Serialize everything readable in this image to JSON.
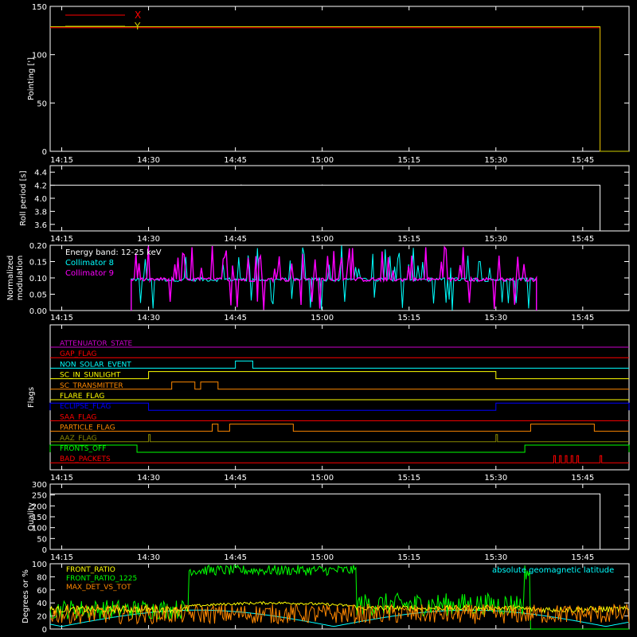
{
  "chart_data": [
    {
      "type": "line",
      "panel": "pointing",
      "ylabel": "Pointing [']",
      "ylim": [
        0,
        150
      ],
      "yticks": [
        0,
        50,
        100,
        150
      ],
      "xlim": [
        "14:13",
        "15:53"
      ],
      "xticks": [
        "14:15",
        "14:30",
        "14:45",
        "15:00",
        "15:15",
        "15:30",
        "15:45"
      ],
      "legend": "top-left",
      "series": [
        {
          "name": "X",
          "color": "#ff0000",
          "x": [
            "14:13",
            "15:48",
            "15:48",
            "15:53"
          ],
          "values": [
            128,
            128,
            0,
            0
          ]
        },
        {
          "name": "Y",
          "color": "#cccc00",
          "x": [
            "14:13",
            "15:48",
            "15:48",
            "15:53"
          ],
          "values": [
            129,
            129,
            0,
            0
          ]
        }
      ]
    },
    {
      "type": "line",
      "panel": "roll",
      "ylabel": "Roll period [s]",
      "ylim": [
        3.5,
        4.5
      ],
      "yticks": [
        "3.6",
        "3.8",
        "4.0",
        "4.2",
        "4.4"
      ],
      "series": [
        {
          "name": "",
          "color": "#ffffff",
          "x": [
            "14:13",
            "15:48",
            "15:48"
          ],
          "values": [
            4.2,
            4.2,
            3.5
          ]
        }
      ]
    },
    {
      "type": "line",
      "panel": "modulation",
      "ylabel_lines": [
        "Normalized",
        "modulation"
      ],
      "ylim": [
        0,
        0.2
      ],
      "yticks": [
        "0.00",
        "0.05",
        "0.10",
        "0.15",
        "0.20"
      ],
      "annotation": "Energy band: 12-25 keV",
      "legend": "top-left",
      "active_range": [
        "14:27",
        "15:37"
      ],
      "baseline": 0.095,
      "series": [
        {
          "name": "Collimator 8",
          "color": "#00ffff"
        },
        {
          "name": "Collimator 9",
          "color": "#ff00ff"
        }
      ]
    },
    {
      "type": "line",
      "panel": "flags",
      "ylabel": "Flags",
      "flags": [
        {
          "name": "ATTENUATOR_STATE",
          "color": "#cc00cc",
          "pulses": []
        },
        {
          "name": "GAP_FLAG",
          "color": "#ff0000",
          "pulses": []
        },
        {
          "name": "NON_SOLAR_EVENT",
          "color": "#00ffff",
          "pulses": [
            [
              "14:45",
              "14:48"
            ]
          ]
        },
        {
          "name": "SC_IN_SUNLIGHT",
          "color": "#ffff00",
          "pulses": [
            [
              "14:30",
              "15:30"
            ]
          ]
        },
        {
          "name": "SC_TRANSMITTER",
          "color": "#ff8800",
          "pulses": [
            [
              "14:34",
              "14:38"
            ],
            [
              "14:39",
              "14:42"
            ]
          ]
        },
        {
          "name": "FLARE_FLAG",
          "color": "#ffff00",
          "pulses": []
        },
        {
          "name": "ECLIPSE_FLAG",
          "color": "#0000ff",
          "pulses": [
            [
              "14:13",
              "14:30"
            ],
            [
              "15:30",
              "15:53"
            ]
          ]
        },
        {
          "name": "SAA_FLAG",
          "color": "#ff0000",
          "pulses": []
        },
        {
          "name": "PARTICLE_FLAG",
          "color": "#ff8800",
          "pulses": [
            [
              "14:41",
              "14:42"
            ],
            [
              "14:44",
              "14:55"
            ],
            [
              "15:36",
              "15:47"
            ]
          ]
        },
        {
          "name": "AAZ_FLAG",
          "color": "#888800",
          "pulses": [
            [
              "14:30",
              "14:30"
            ],
            [
              "15:30",
              "15:30"
            ]
          ]
        },
        {
          "name": "FRONTS_OFF",
          "color": "#00ff00",
          "pulses": [
            [
              "14:13",
              "14:28"
            ],
            [
              "15:35",
              "15:53"
            ]
          ]
        },
        {
          "name": "BAD_PACKETS",
          "color": "#ff0000",
          "pulses": [
            [
              "15:40",
              "15:40"
            ],
            [
              "15:41",
              "15:41"
            ],
            [
              "15:42",
              "15:42"
            ],
            [
              "15:43",
              "15:43"
            ],
            [
              "15:44",
              "15:44"
            ],
            [
              "15:48",
              "15:48"
            ]
          ]
        }
      ]
    },
    {
      "type": "line",
      "panel": "quality",
      "ylabel": "Quality",
      "ylim": [
        0,
        300
      ],
      "yticks": [
        0,
        50,
        100,
        150,
        200,
        250,
        300
      ],
      "series": [
        {
          "name": "",
          "color": "#ffffff",
          "x": [
            "14:13",
            "15:48",
            "15:48"
          ],
          "values": [
            255,
            255,
            0
          ]
        }
      ]
    },
    {
      "type": "line",
      "panel": "ratios",
      "ylabel": "Degrees or %",
      "ylim": [
        0,
        100
      ],
      "yticks": [
        0,
        20,
        40,
        60,
        80,
        100
      ],
      "legend": "top-left",
      "series": [
        {
          "name": "FRONT_RATIO",
          "color": "#ffff00"
        },
        {
          "name": "FRONT_RATIO_1225",
          "color": "#00ff00"
        },
        {
          "name": "MAX_DET_VS_TOT",
          "color": "#ff8800"
        },
        {
          "name": "absolute geomagnetic latitude",
          "color": "#00ffff"
        }
      ]
    }
  ],
  "colors": {
    "axes": "#ffffff",
    "background": "#000000"
  }
}
